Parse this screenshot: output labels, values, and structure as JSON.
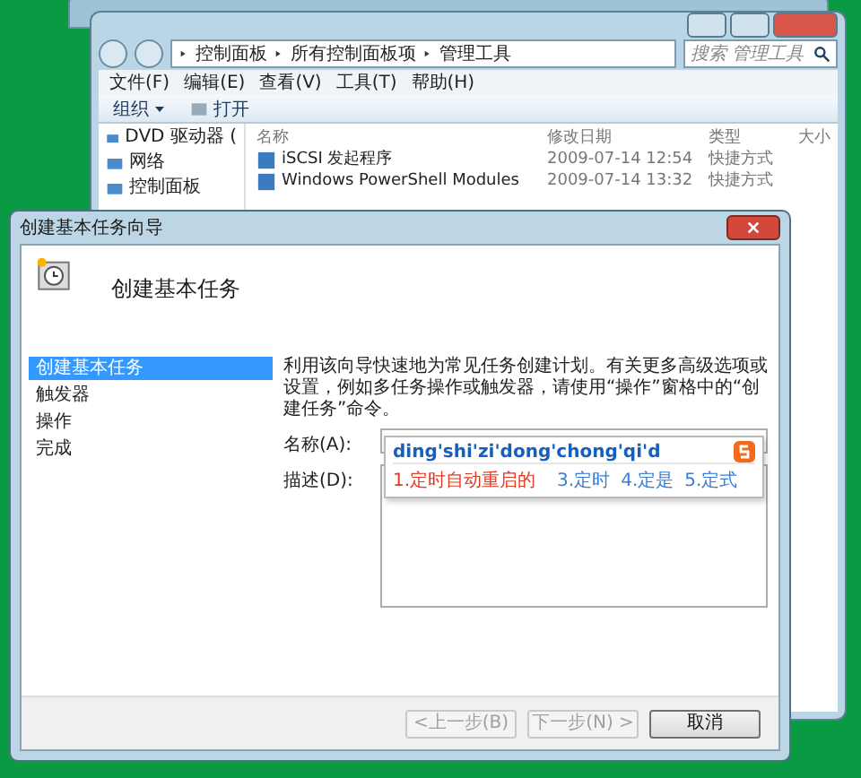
{
  "explorer": {
    "breadcrumb": [
      "控制面板",
      "所有控制面板项",
      "管理工具"
    ],
    "search": {
      "placeholder": "搜索 管理工具"
    },
    "menu": [
      "文件(F)",
      "编辑(E)",
      "查看(V)",
      "工具(T)",
      "帮助(H)"
    ],
    "toolbar": [
      {
        "label": "组织",
        "kind": "dropdown"
      },
      {
        "label": "打开",
        "kind": "icon"
      }
    ],
    "nav_items": [
      "DVD 驱动器 (",
      "网络",
      "控制面板"
    ],
    "columns": [
      "名称",
      "修改日期",
      "类型",
      "大小"
    ],
    "rows": [
      {
        "name": "iSCSI 发起程序",
        "date": "2009-07-14 12:54",
        "type": "快捷方式"
      },
      {
        "name": "Windows PowerShell Modules",
        "date": "2009-07-14 13:32",
        "type": "快捷方式"
      }
    ]
  },
  "wizard": {
    "title": "创建基本任务向导",
    "heading": "创建基本任务",
    "steps": [
      {
        "label": "创建基本任务",
        "selected": true
      },
      {
        "label": "触发器",
        "selected": false
      },
      {
        "label": "操作",
        "selected": false
      },
      {
        "label": "完成",
        "selected": false
      }
    ],
    "intro": "利用该向导快速地为常见任务创建计划。有关更多高级选项或设置，例如多任务操作或触发器，请使用“操作”窗格中的“创建任务”命令。",
    "fields": [
      {
        "label": "名称(A):",
        "kind": "line"
      },
      {
        "label": "描述(D):",
        "kind": "area"
      }
    ],
    "ime": {
      "composition": "ding'shi'zi'dong'chong'qi'd",
      "candidates": [
        {
          "text": "1.定时自动重启的",
          "selected": true
        },
        {
          "text": "3.定时",
          "selected": false
        },
        {
          "text": "4.定是",
          "selected": false
        },
        {
          "text": "5.定式",
          "selected": false
        }
      ]
    },
    "buttons": [
      {
        "label": "<上一步(B)",
        "disabled": true
      },
      {
        "label": "下一步(N) >",
        "disabled": true
      },
      {
        "label": "取消",
        "disabled": false
      }
    ]
  }
}
